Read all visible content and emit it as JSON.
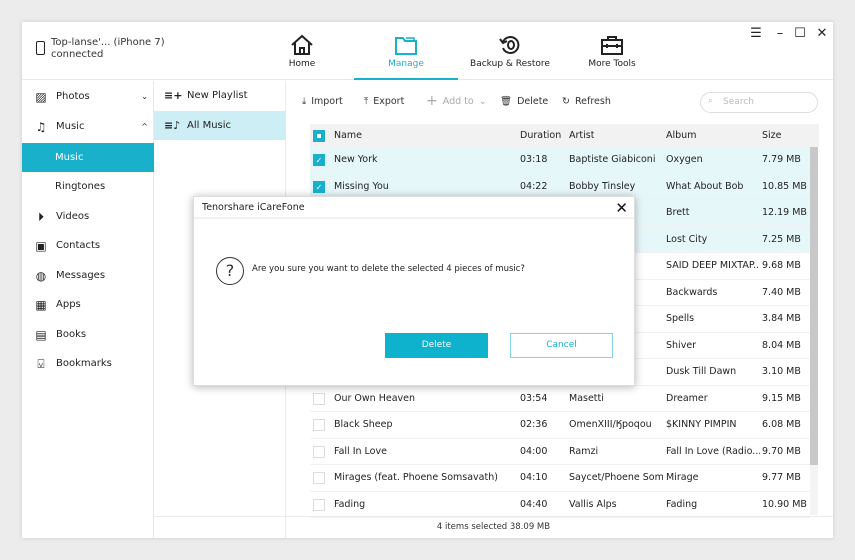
{
  "device": {
    "name": "Top-lanse'... (iPhone 7)",
    "status": "connected"
  },
  "nav": [
    {
      "label": "Home",
      "icon": "home-icon"
    },
    {
      "label": "Manage",
      "icon": "folder-icon",
      "active": true
    },
    {
      "label": "Backup & Restore",
      "icon": "backup-restore-icon"
    },
    {
      "label": "More Tools",
      "icon": "toolbox-icon"
    }
  ],
  "window_controls": {
    "menu": "☰",
    "minimize": "–",
    "maximize": "☐",
    "close": "✕"
  },
  "sidebar": [
    {
      "label": "Photos",
      "icon": "photo-icon"
    },
    {
      "label": "Music",
      "icon": "music-icon"
    },
    {
      "label": "Music",
      "sub": true,
      "selected": true
    },
    {
      "label": "Ringtones",
      "sub": true
    },
    {
      "label": "Videos",
      "icon": "play-icon"
    },
    {
      "label": "Contacts",
      "icon": "contact-icon"
    },
    {
      "label": "Messages",
      "icon": "message-icon"
    },
    {
      "label": "Apps",
      "icon": "apps-icon"
    },
    {
      "label": "Books",
      "icon": "book-icon"
    },
    {
      "label": "Bookmarks",
      "icon": "bookmark-icon"
    }
  ],
  "playlists": [
    {
      "label": "New Playlist",
      "icon": "playlist-add-icon"
    },
    {
      "label": "All Music",
      "icon": "playlist-music-icon",
      "selected": true
    }
  ],
  "toolbar": {
    "import": "Import",
    "export": "Export",
    "add_to": "Add to",
    "delete": "Delete",
    "refresh": "Refresh",
    "search_placeholder": "Search"
  },
  "table": {
    "headers": {
      "name": "Name",
      "duration": "Duration",
      "artist": "Artist",
      "album": "Album",
      "size": "Size"
    },
    "rows": [
      {
        "checked": true,
        "name": "New York",
        "duration": "03:18",
        "artist": "Baptiste Giabiconi",
        "album": "Oxygen",
        "size": "7.79 MB"
      },
      {
        "checked": true,
        "name": "Missing You",
        "duration": "04:22",
        "artist": "Bobby Tinsley",
        "album": "What About Bob",
        "size": "10.85 MB"
      },
      {
        "checked": true,
        "name": "",
        "duration": "",
        "artist": "",
        "album": "Brett",
        "size": "12.19 MB"
      },
      {
        "checked": true,
        "name": "",
        "duration": "",
        "artist": "",
        "album": "Lost City",
        "size": "7.25 MB"
      },
      {
        "checked": false,
        "name": "",
        "duration": "",
        "artist": "",
        "album": "SAID DEEP MIXTAP...",
        "size": "9.68 MB"
      },
      {
        "checked": false,
        "name": "",
        "duration": "",
        "artist": "",
        "album": "Backwards",
        "size": "7.40 MB"
      },
      {
        "checked": false,
        "name": "",
        "duration": "",
        "artist": "",
        "album": "Spells",
        "size": "3.84 MB"
      },
      {
        "checked": false,
        "name": "",
        "duration": "",
        "artist": "",
        "album": "Shiver",
        "size": "8.04 MB"
      },
      {
        "checked": false,
        "name": "",
        "duration": "",
        "artist": "",
        "album": "Dusk Till Dawn",
        "size": "3.10 MB"
      },
      {
        "checked": false,
        "name": "Our Own Heaven",
        "duration": "03:54",
        "artist": "Masetti",
        "album": "Dreamer",
        "size": "9.15 MB"
      },
      {
        "checked": false,
        "name": "Black Sheep",
        "duration": "02:36",
        "artist": "OmenXIII/Ӄpoqou",
        "album": "$KINNY PIMPIN",
        "size": "6.08 MB"
      },
      {
        "checked": false,
        "name": "Fall In Love",
        "duration": "04:00",
        "artist": "Ramzi",
        "album": "Fall In Love (Radio...",
        "size": "9.70 MB"
      },
      {
        "checked": false,
        "name": "Mirages (feat. Phoene Somsavath)",
        "duration": "04:10",
        "artist": "Saycet/Phoene Som...",
        "album": "Mirage",
        "size": "9.77 MB"
      },
      {
        "checked": false,
        "name": "Fading",
        "duration": "04:40",
        "artist": "Vallis Alps",
        "album": "Fading",
        "size": "10.90 MB"
      }
    ]
  },
  "footer": {
    "status": "4 items selected 38.09 MB"
  },
  "dialog": {
    "title": "Tenorshare iCareFone",
    "message": "Are you sure you want to delete the selected 4 pieces of music?",
    "confirm": "Delete",
    "cancel": "Cancel"
  },
  "colors": {
    "accent": "#19b0cc",
    "selected_row": "#e6f7fa"
  }
}
